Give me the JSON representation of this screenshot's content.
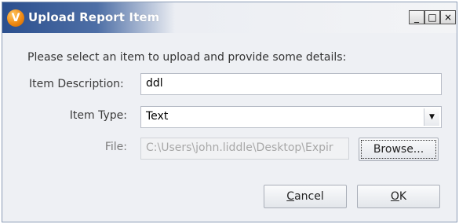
{
  "window": {
    "title": "Upload Report Item",
    "icon_letter": "V",
    "controls": {
      "minimize": "_",
      "maximize": "□",
      "close": "×"
    }
  },
  "form": {
    "instructions": "Please select an item to upload and provide some details:",
    "description": {
      "label": "Item Description:",
      "value": "ddl"
    },
    "item_type": {
      "label": "Item Type:",
      "value": "Text"
    },
    "file": {
      "label": "File:",
      "value": "C:\\Users\\john.liddle\\Desktop\\Expir"
    }
  },
  "buttons": {
    "browse": "Browse...",
    "cancel_prefix": "C",
    "cancel_rest": "ancel",
    "ok_prefix": "O",
    "ok_rest": "K"
  },
  "colors": {
    "title_bar_start": "#2b4f8e",
    "dialog_bg": "#eef0f4",
    "icon_orange": "#f08a12"
  }
}
